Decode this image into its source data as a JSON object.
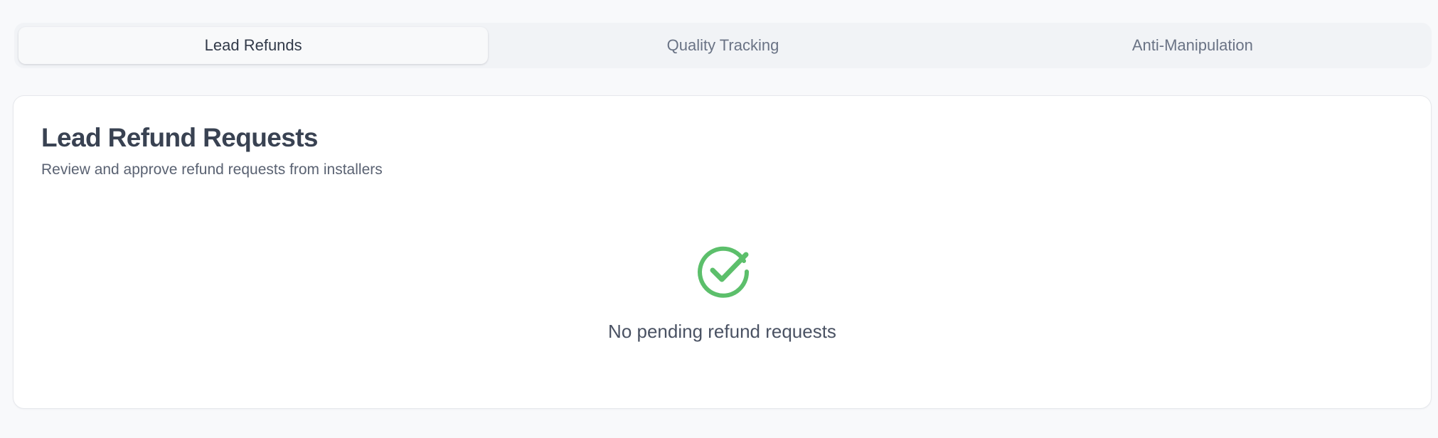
{
  "tabs": [
    {
      "label": "Lead Refunds",
      "active": true
    },
    {
      "label": "Quality Tracking",
      "active": false
    },
    {
      "label": "Anti-Manipulation",
      "active": false
    }
  ],
  "panel": {
    "title": "Lead Refund Requests",
    "subtitle": "Review and approve refund requests from installers",
    "empty_state": {
      "icon": "check-circle-icon",
      "icon_color": "#5cbf6b",
      "message": "No pending refund requests"
    }
  }
}
